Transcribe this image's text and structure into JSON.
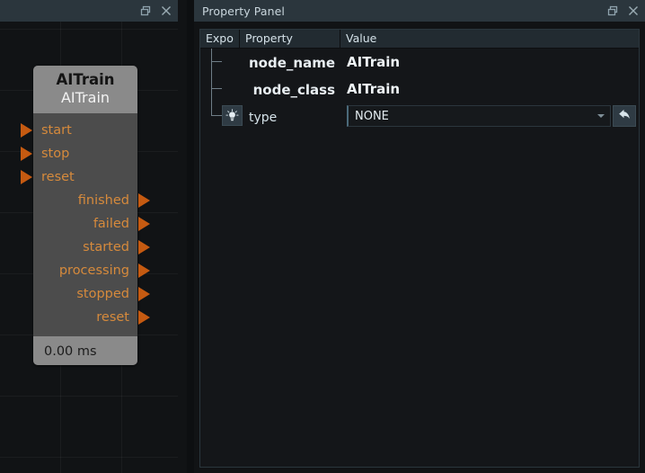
{
  "graph_panel": {
    "title": "",
    "window_buttons": [
      {
        "name": "restore-icon",
        "label": "restore"
      },
      {
        "name": "close-icon",
        "label": "close"
      }
    ],
    "node": {
      "title": "AITrain",
      "subtitle": "AITrain",
      "inputs": [
        {
          "label": "start"
        },
        {
          "label": "stop"
        },
        {
          "label": "reset"
        }
      ],
      "outputs": [
        {
          "label": "finished"
        },
        {
          "label": "failed"
        },
        {
          "label": "started"
        },
        {
          "label": "processing"
        },
        {
          "label": "stopped"
        },
        {
          "label": "reset"
        }
      ],
      "footer": "0.00 ms",
      "colors": {
        "header": "#8a8a8a",
        "body": "#4c4c4c",
        "port": "#c55a11",
        "port_label": "#d68a3c"
      }
    }
  },
  "property_panel": {
    "title": "Property Panel",
    "window_buttons": [
      {
        "name": "restore-icon",
        "label": "restore"
      },
      {
        "name": "close-icon",
        "label": "close"
      }
    ],
    "table": {
      "columns": [
        "Expo",
        "Property",
        "Value"
      ],
      "rows": [
        {
          "expo": "",
          "property": "node_name",
          "value": "AITrain",
          "type": "text"
        },
        {
          "expo": "",
          "property": "node_class",
          "value": "AITrain",
          "type": "text"
        },
        {
          "expo": "bulb-icon",
          "property": "type",
          "value": "NONE",
          "type": "combo",
          "revert": "revert-icon"
        }
      ]
    }
  },
  "theme": {
    "titlebar": "#2b363d",
    "panel_bg": "#111315",
    "accent": "#c55a11"
  }
}
